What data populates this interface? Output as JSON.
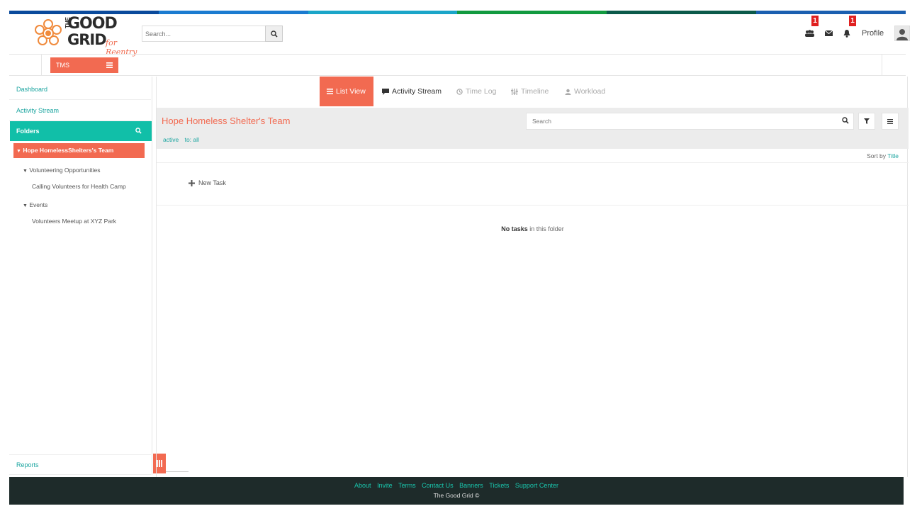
{
  "brand": {
    "word1": "GOOD",
    "word2": "GRID",
    "the": "THE",
    "tagline": "for Reentry",
    "stripe_colors": [
      "#0a4a9c",
      "#1a7bd0",
      "#1aa5c8",
      "#129a3f",
      "#0b5a4a",
      "#1a5fb0"
    ]
  },
  "header": {
    "search_placeholder": "Search...",
    "groups_badge": "1",
    "bell_badge": "1",
    "profile_label": "Profile"
  },
  "subbar": {
    "tms_label": "TMS"
  },
  "sidebar": {
    "dashboard": "Dashboard",
    "activity_stream": "Activity Stream",
    "folders": "Folders",
    "team": "Hope HomelessShelters's Team",
    "tree": [
      {
        "label": "Volunteering Opportunities",
        "child": "Calling Volunteers for Health Camp"
      },
      {
        "label": "Events",
        "child": "Volunteers Meetup at XYZ Park"
      }
    ],
    "reports": "Reports"
  },
  "tabs": {
    "list_view": "List View",
    "activity_stream": "Activity Stream",
    "time_log": "Time Log",
    "timeline": "Timeline",
    "workload": "Workload"
  },
  "folder": {
    "title": "Hope Homeless Shelter's Team",
    "tag_status": "active",
    "tag_to": "to: all",
    "search_placeholder": "Search",
    "sort_prefix": "Sort by",
    "sort_field": "Title",
    "new_task": "New Task",
    "empty_bold": "No tasks",
    "empty_rest": " in this folder"
  },
  "footer": {
    "links": [
      "About",
      "Invite",
      "Terms",
      "Contact Us",
      "Banners",
      "Tickets",
      "Support Center"
    ],
    "copyright": "The Good Grid ©"
  },
  "colors": {
    "accent": "#f26a51",
    "teal": "#11bfa8",
    "link": "#1ba5a0",
    "footer_bg": "#1e2b2a"
  }
}
